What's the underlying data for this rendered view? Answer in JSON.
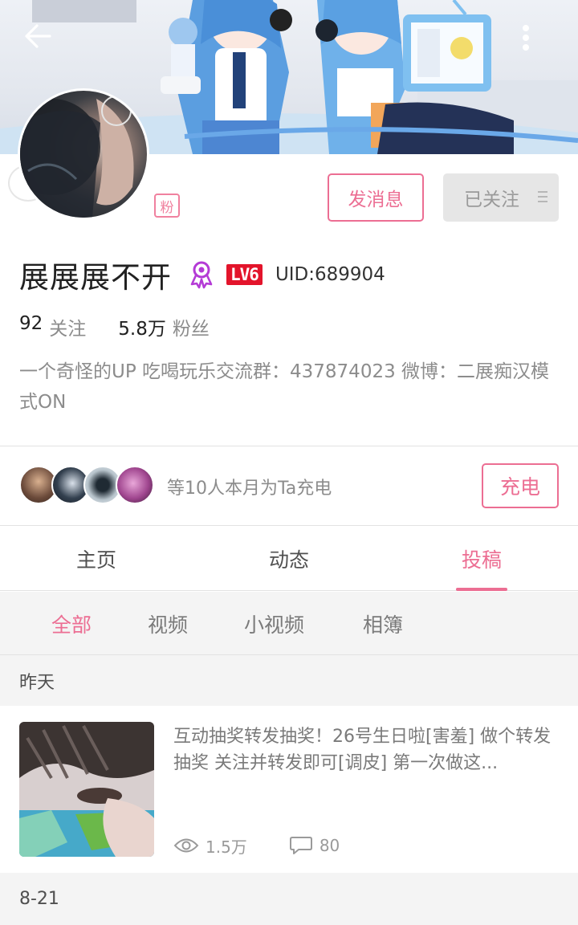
{
  "profile": {
    "fan_badge": "粉",
    "name": "展展展不开",
    "level": "LV6",
    "uid": "UID:689904",
    "following_count": "92",
    "following_label": "关注",
    "followers_count": "5.8万",
    "followers_label": "粉丝",
    "bio": "一个奇怪的UP  吃喝玩乐交流群：437874023  微博：二展痴汉模式ON"
  },
  "actions": {
    "message_label": "发消息",
    "follow_label": "已关注"
  },
  "charge": {
    "text": "等10人本月为Ta充电",
    "button_label": "充电"
  },
  "tabs": [
    {
      "label": "主页",
      "active": false
    },
    {
      "label": "动态",
      "active": false
    },
    {
      "label": "投稿",
      "active": true
    }
  ],
  "filters": [
    {
      "label": "全部",
      "active": true
    },
    {
      "label": "视频",
      "active": false
    },
    {
      "label": "小视频",
      "active": false
    },
    {
      "label": "相簿",
      "active": false
    }
  ],
  "sections": [
    {
      "date": "昨天",
      "post": {
        "text": "互动抽奖转发抽奖！26号生日啦[害羞] 做个转发抽奖 关注并转发即可[调皮] 第一次做这...",
        "views": "1.5万",
        "comments": "80"
      }
    },
    {
      "date": "8-21"
    }
  ],
  "icons": [
    "back-arrow-icon",
    "more-vertical-icon",
    "medal-icon",
    "menu-lines-icon",
    "eye-icon",
    "comment-icon"
  ],
  "colors": {
    "accent": "#ec6e93",
    "level_badge": "#e3142b",
    "medal": "#b43bd6"
  }
}
